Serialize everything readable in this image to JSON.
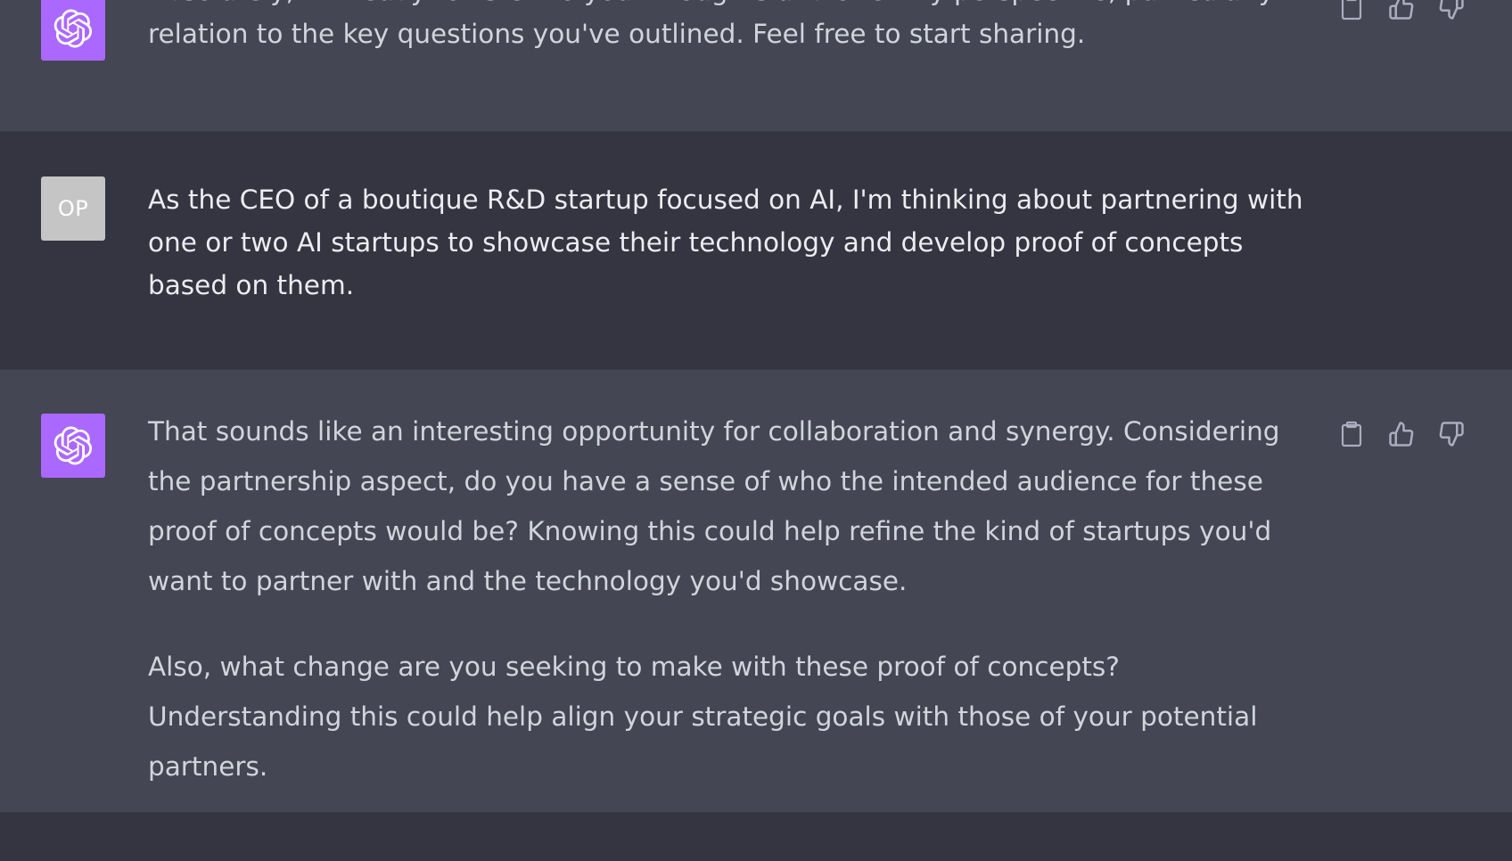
{
  "colors": {
    "assistant_bg": "#444654",
    "user_bg": "#343541",
    "assistant_avatar": "#ab68ff",
    "user_avatar": "#c5c5c5",
    "text": "#d1d5db"
  },
  "messages": [
    {
      "role": "assistant",
      "avatar_icon": "openai-logo-icon",
      "paragraphs": [
        "Absolutely, I'm ready to listen to your thoughts and offer my perspective, particularly in relation to the key questions you've outlined. Feel free to start sharing."
      ]
    },
    {
      "role": "user",
      "avatar_label": "OP",
      "paragraphs": [
        "As the CEO of a boutique R&D startup focused on AI, I'm thinking about partnering with one or two AI startups to showcase their technology and develop proof of concepts based on them."
      ]
    },
    {
      "role": "assistant",
      "avatar_icon": "openai-logo-icon",
      "paragraphs": [
        "That sounds like an interesting opportunity for collaboration and synergy. Considering the partnership aspect, do you have a sense of who the intended audience for these proof of concepts would be? Knowing this could help refine the kind of startups you'd want to partner with and the technology you'd showcase.",
        "Also, what change are you seeking to make with these proof of concepts? Understanding this could help align your strategic goals with those of your potential partners."
      ],
      "actions": [
        "copy-icon",
        "thumbs-up-icon",
        "thumbs-down-icon"
      ]
    }
  ]
}
